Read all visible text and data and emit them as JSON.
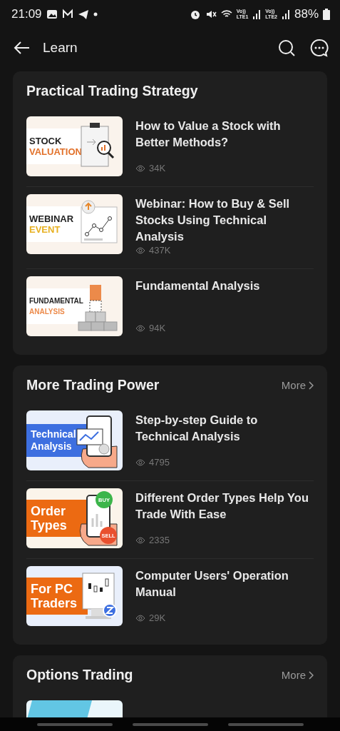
{
  "status_bar": {
    "time": "21:09",
    "battery": "88%",
    "sims": [
      {
        "top": "Vo))",
        "bottom": "LTE1"
      },
      {
        "top": "Vo))",
        "bottom": "LTE2"
      }
    ]
  },
  "header": {
    "title": "Learn"
  },
  "sections": [
    {
      "title": "Practical Trading Strategy",
      "items": [
        {
          "title": "How to Value a Stock with Better Methods?",
          "views": "34K",
          "thumbnail": {
            "kind": "plain",
            "lines": [
              "STOCK",
              "VALUATION"
            ],
            "color": "#e2712a",
            "background": {
              "color": "#faf3ec"
            },
            "illustration": {
              "kind": "clipboard"
            }
          }
        },
        {
          "title": "Webinar: How to Buy & Sell Stocks Using Technical Analysis",
          "views": "437K",
          "thumbnail": {
            "kind": "plain",
            "lines": [
              "WEBINAR",
              "EVENT"
            ],
            "color": "#e7b122",
            "background": {
              "color": "#faf3ec"
            },
            "illustration": {
              "kind": "chart"
            }
          }
        },
        {
          "title": "Fundamental Analysis",
          "views": "94K",
          "thumbnail": {
            "kind": "plain",
            "lines": [
              "FUNDAMENTAL",
              "ANALYSIS"
            ],
            "color": "#ec8a4a",
            "background": {
              "color": "#faf3ec"
            },
            "illustration": {
              "kind": "blocks"
            }
          }
        }
      ]
    },
    {
      "title": "More Trading Power",
      "more": "More",
      "items": [
        {
          "title": "Step-by-step Guide to Technical Analysis",
          "views": "4795",
          "thumbnail": {
            "kind": "banner",
            "lines": [
              "Technical",
              "Analysis"
            ],
            "color": "#3d6fe0",
            "background": {
              "color": "#e9effb"
            },
            "illustration": {
              "kind": "phone-chart"
            }
          }
        },
        {
          "title": "Different Order Types Help You Trade With Ease",
          "views": "2335",
          "thumbnail": {
            "kind": "banner",
            "lines": [
              "Order",
              "Types"
            ],
            "color": "#ec6a12",
            "background": {
              "color": "#fbf4ea"
            },
            "illustration": {
              "kind": "phone-trade"
            },
            "badges": [
              "BUY",
              "SELL"
            ]
          }
        },
        {
          "title": "Computer Users' Operation Manual",
          "views": "29K",
          "thumbnail": {
            "kind": "banner",
            "lines": [
              "For PC",
              "Traders"
            ],
            "color": "#ec6a12",
            "background": {
              "color": "#e9effb"
            },
            "illustration": {
              "kind": "monitor"
            }
          }
        }
      ]
    },
    {
      "title": "Options Trading",
      "more": "More",
      "items": [
        {
          "thumbnail": {
            "kind": "partial",
            "color": "#62c6e4",
            "background": {
              "color": "#eaf6fb"
            }
          }
        }
      ]
    }
  ]
}
